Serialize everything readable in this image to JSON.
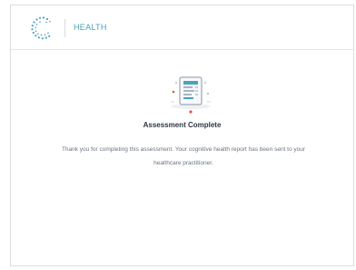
{
  "header": {
    "brand": "HEALTH",
    "logo_icon": "dotted-c-logo-icon"
  },
  "main": {
    "illustration_icon": "report-clipboard-icon",
    "title": "Assessment Complete",
    "message": "Thank you for completing this assessment. Your cognitive health report has been sent to your healthcare practitioner."
  },
  "colors": {
    "brand": "#4aa2be",
    "accent_red": "#e0544b"
  }
}
